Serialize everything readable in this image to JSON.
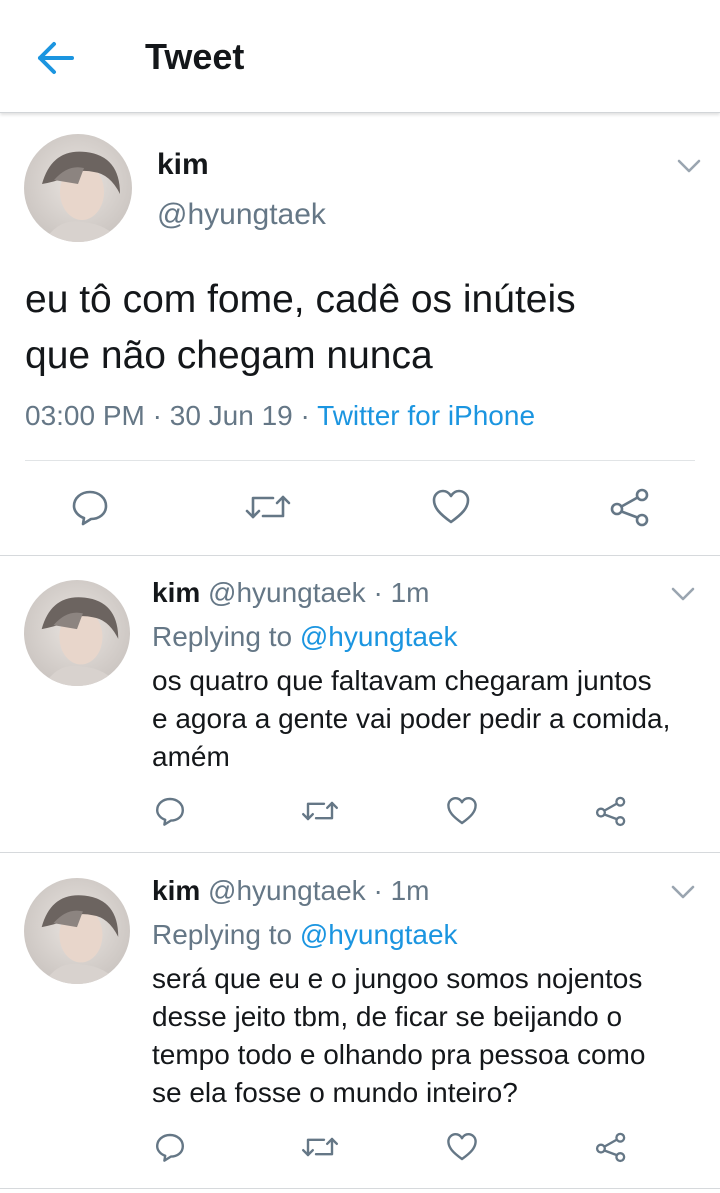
{
  "header": {
    "title": "Tweet"
  },
  "main_tweet": {
    "name": "kim",
    "handle": "@hyungtaek",
    "text_line1": "eu tô com fome, cadê os inúteis",
    "text_line2": "que não chegam nunca",
    "time": "03:00 PM",
    "date": "30 Jun 19",
    "separator": "·",
    "source": "Twitter for iPhone"
  },
  "replies": [
    {
      "name": "kim",
      "handle": "@hyungtaek",
      "age": "1m",
      "separator": "·",
      "replying_to_label": "Replying to",
      "replying_to_handle": "@hyungtaek",
      "lines": [
        "os quatro que faltavam chegaram juntos",
        "e agora a gente vai poder pedir a comida,",
        "amém"
      ]
    },
    {
      "name": "kim",
      "handle": "@hyungtaek",
      "age": "1m",
      "separator": "·",
      "replying_to_label": "Replying to",
      "replying_to_handle": "@hyungtaek",
      "lines": [
        "será que eu e o jungoo somos nojentos",
        "desse jeito tbm, de ficar se beijando o",
        "tempo todo e olhando pra pessoa como",
        "se ela fosse o mundo inteiro?"
      ]
    }
  ],
  "icons": [
    "back-arrow-icon",
    "chevron-down-icon",
    "reply-icon",
    "retweet-icon",
    "like-icon",
    "share-icon"
  ],
  "colors": {
    "accent": "#1b95e0",
    "muted": "#657786",
    "text": "#14171a"
  }
}
